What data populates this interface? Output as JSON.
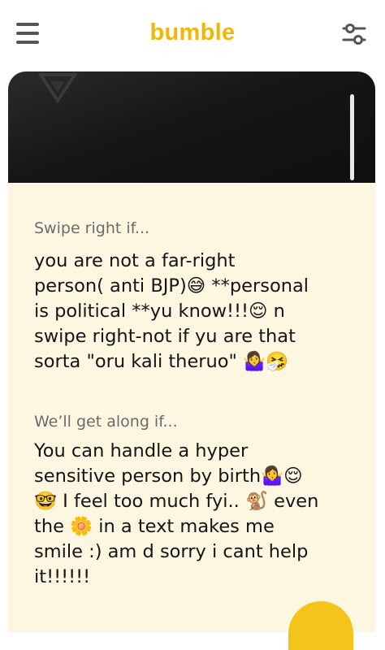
{
  "header": {
    "logo": "bumble",
    "menu_icon": "hamburger-menu-icon",
    "filter_icon": "sliders-filter-icon"
  },
  "colors": {
    "brand": "#f2b705",
    "card_bg": "#fdf6e1",
    "text": "#151515",
    "label": "#6b6b6b"
  },
  "profile": {
    "prompts": [
      {
        "label": "Swipe right if...",
        "answer_lines": [
          "you are not a far-right",
          "person( anti BJP)😅 **personal",
          "is political **yu know!!!😌 n",
          "swipe right-not if yu are that",
          "sorta \"oru kali theruo\" 🤷‍♀️🤧"
        ]
      },
      {
        "label": "We’ll get along if...",
        "answer_lines": [
          "You can handle a hyper",
          "sensitive person by birth🤷‍♀️😌",
          "🤓 I feel too much fyi.. 🐒 even",
          "the 🌼 in a text makes me",
          "smile :) am d sorry i cant help",
          "it!!!!!!"
        ]
      }
    ]
  }
}
